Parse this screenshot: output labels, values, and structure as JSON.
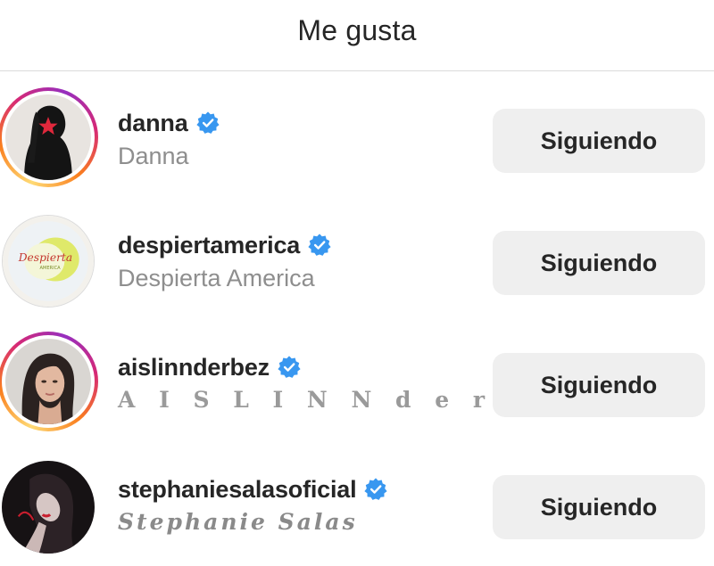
{
  "header": {
    "title": "Me gusta"
  },
  "users": [
    {
      "username": "danna",
      "fullname": "Danna",
      "button": "Siguiendo",
      "verified": true,
      "story_ring": true,
      "avatar": "silhouette-red-star"
    },
    {
      "username": "despiertamerica",
      "fullname": "Despierta America",
      "button": "Siguiendo",
      "verified": true,
      "story_ring": false,
      "avatar": "despierta-america-logo"
    },
    {
      "username": "aislinnderbez",
      "fullname": "A I S L I N N d e r b e z",
      "button": "Siguiendo",
      "verified": true,
      "story_ring": true,
      "avatar": "woman-portrait"
    },
    {
      "username": "stephaniesalasoficial",
      "fullname": "Stephanie Salas",
      "button": "Siguiendo",
      "verified": true,
      "story_ring": false,
      "avatar": "woman-dark-portrait"
    }
  ],
  "avatar_logo_text": {
    "main": "Despierta",
    "sub": "AMERICA"
  },
  "colors": {
    "verified": "#3897f0",
    "button_bg": "#efefef",
    "text_primary": "#262626",
    "text_secondary": "#8e8e8e"
  }
}
